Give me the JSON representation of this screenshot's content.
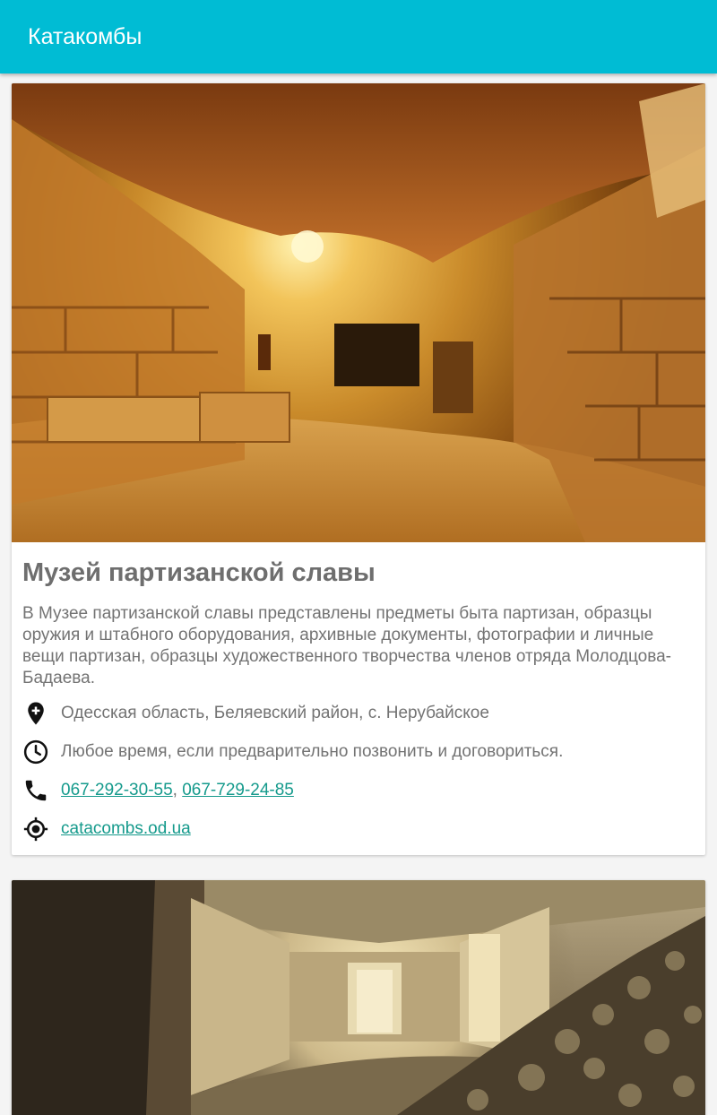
{
  "appbar": {
    "title": "Катакомбы"
  },
  "cards": [
    {
      "title": "Музей партизанской славы",
      "description": "В Музее партизанской славы представлены предметы быта партизан, образцы оружия и штабного оборудования, архивные документы, фотографии и личные вещи партизан, образцы художественного творчества членов отряда Молодцова-Бадаева.",
      "address": "Одесская область, Беляевский район, с. Нерубайское",
      "hours": "Любое время, если предварительно позвонить и договориться.",
      "phones": [
        "067-292-30-55",
        "067-729-24-85"
      ],
      "phone_separator": ", ",
      "website": "catacombs.od.ua",
      "icons": {
        "address": "location-pin-icon",
        "hours": "clock-icon",
        "phone": "phone-icon",
        "website": "gps-target-icon"
      },
      "image": "catacomb-museum-photo"
    },
    {
      "image": "catacomb-tunnel-photo"
    }
  ],
  "colors": {
    "appbar": "#00bcd4",
    "link": "#159a8c",
    "title": "#6e6e6e",
    "text": "#737373",
    "background": "#f4f4f4"
  }
}
